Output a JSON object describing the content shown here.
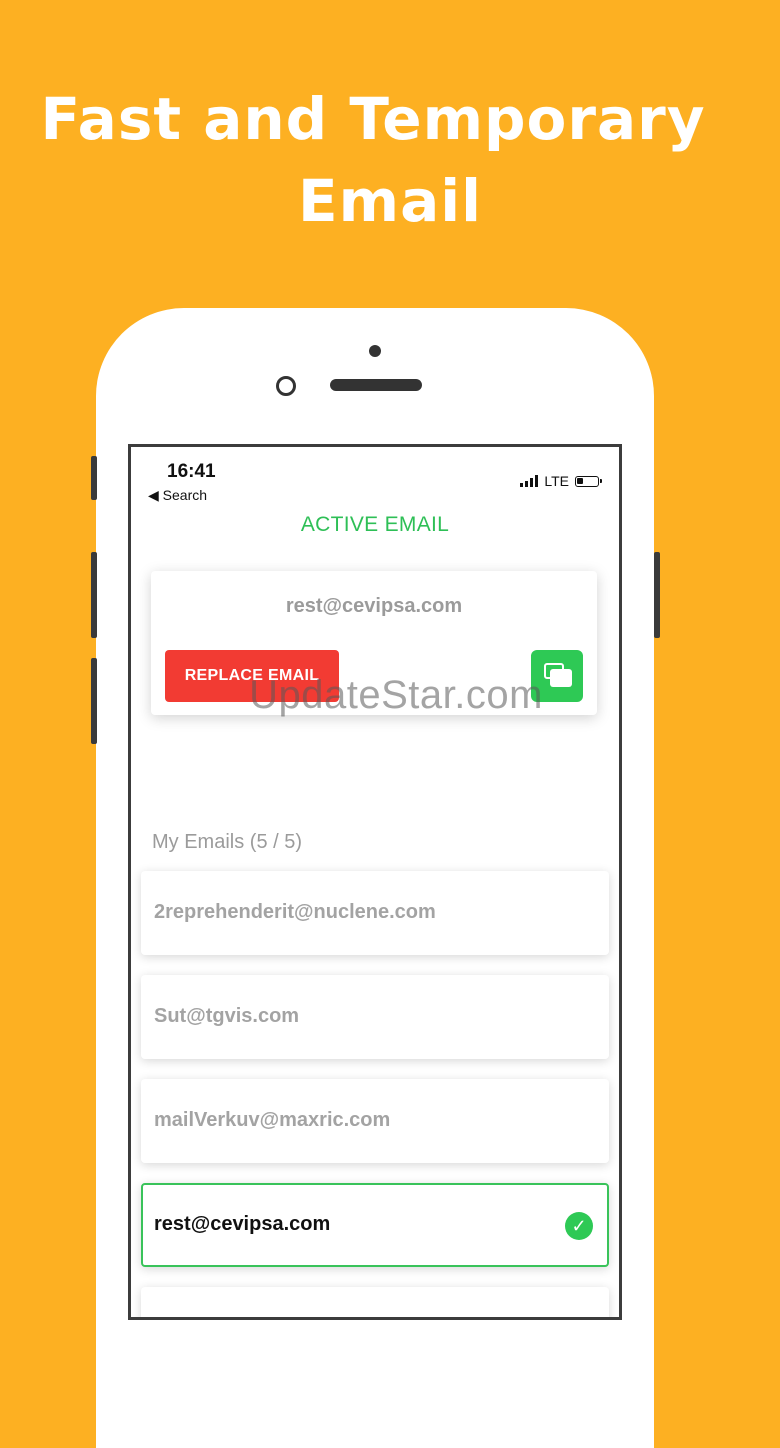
{
  "promo": {
    "headline_line1": "Fast and Temporary",
    "headline_line2": "Email"
  },
  "status_bar": {
    "time": "16:41",
    "back_label": "◀ Search",
    "network": "LTE"
  },
  "active": {
    "title": "ACTIVE EMAIL",
    "email": "rest@cevipsa.com",
    "replace_label": "REPLACE EMAIL"
  },
  "watermark": "UpdateStar.com",
  "my_emails": {
    "label": "My Emails (5 / 5)",
    "items": [
      {
        "address": "2reprehenderit@nuclene.com",
        "selected": false
      },
      {
        "address": "Sut@tgvis.com",
        "selected": false
      },
      {
        "address": "mailVerkuv@maxric.com",
        "selected": false
      },
      {
        "address": "rest@cevipsa.com",
        "selected": true
      },
      {
        "address": "",
        "selected": false
      }
    ]
  },
  "colors": {
    "background": "#FDB022",
    "accent_green": "#2EC955",
    "replace_red": "#F23B33"
  },
  "icons": {
    "copy": "copy-icon",
    "selected": "check-circle-icon"
  }
}
